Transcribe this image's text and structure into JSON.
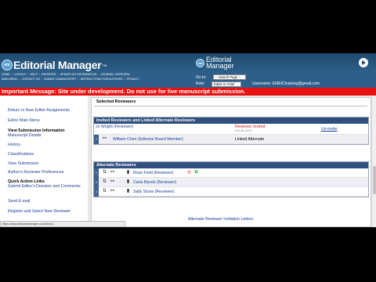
{
  "app": {
    "logo_badge": "em",
    "logo_text": "Editorial Manager",
    "logo_tm": "TM",
    "logo2_line1": "Editorial",
    "logo2_line2": "Manager"
  },
  "nav": {
    "row1": [
      "HOME",
      "LOGOUT",
      "HELP",
      "REGISTER",
      "UPDATE MY INFORMATION",
      "JOURNAL OVERVIEW"
    ],
    "row2": [
      "MAIN MENU",
      "CONTACT US",
      "SUBMIT A MANUSCRIPT",
      "INSTRUCTIONS FOR AUTHORS",
      "PRIVACY"
    ]
  },
  "header": {
    "goto_label": "Go to:",
    "goto_value": "-- Search Page --",
    "role_label": "Role:",
    "role_value": "Editor in Chief",
    "username_label": "Username:",
    "username_value": "EMEICtraining@gmail.com"
  },
  "banner": {
    "text": "Important Message: Site under development. Do not use for live manuscript submission."
  },
  "sidebar": {
    "return_link": "Return to New Editor Assignments",
    "main_menu": "Editor Main Menu",
    "view_info_head": "View Submission Information",
    "manuscript_details": "Manuscript Details",
    "history": "History",
    "classifications": "Classifications",
    "view_submission": "View Submission",
    "authors_prefs": "Author's Reviewer Preferences",
    "quick_head": "Quick Action Links",
    "submit_decision": "Submit Editor's Decision and Comments",
    "send_email": "Send E-mail",
    "register_select": "Register and Select New Reviewer"
  },
  "main": {
    "selected_title": "Selected Reviewers",
    "invited_head": "Invited Reviewers and Linked Alternate Reviewers",
    "invited": {
      "name": "Jo Wright (Reviewer)",
      "status": "Reviewer Invited",
      "date": "Oct 26, 2011",
      "action": "Un-invite"
    },
    "linked": {
      "num": "1",
      "name": "William Chen (Editorial Board Member)",
      "status": "Linked Alternate"
    },
    "alternate_head": "Alternate Reviewers",
    "alternates": [
      {
        "num": "1",
        "name": "Rose Field (Reviewer)"
      },
      {
        "num": "2",
        "name": "Carla Bareis (Reviewer)"
      },
      {
        "num": "3",
        "name": "Sally Stone (Reviewer)"
      }
    ],
    "bottom_link": "Alternate Reviewer Invitation Letters"
  },
  "status": {
    "url": "https://www.editorialmanager.com/demo/..."
  },
  "colors": {
    "header": "#2d5f8a",
    "banner": "#e81010",
    "panel_head": "#2f4f7f",
    "link": "#1d3f91"
  }
}
